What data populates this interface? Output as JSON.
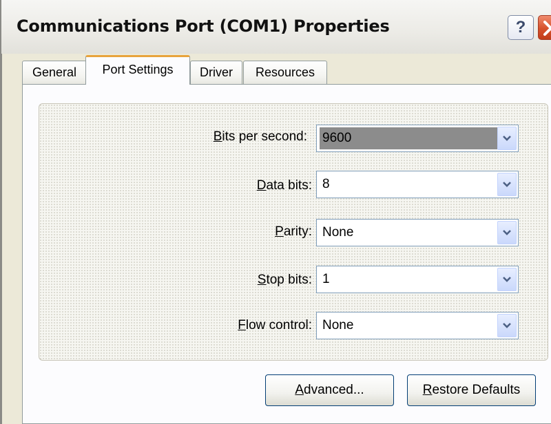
{
  "window": {
    "title": "Communications Port (COM1) Properties",
    "help_label": "?"
  },
  "tabs": [
    {
      "label": "General",
      "active": false
    },
    {
      "label": "Port Settings",
      "active": true
    },
    {
      "label": "Driver",
      "active": false
    },
    {
      "label": "Resources",
      "active": false
    }
  ],
  "settings": {
    "bits_per_second": {
      "label_access": "B",
      "label_rest": "its per second:",
      "value": "9600"
    },
    "data_bits": {
      "label_access": "D",
      "label_rest": "ata bits:",
      "value": "8"
    },
    "parity": {
      "label_access": "P",
      "label_rest": "arity:",
      "value": "None"
    },
    "stop_bits": {
      "label_access": "S",
      "label_rest": "top bits:",
      "value": "1"
    },
    "flow_control": {
      "label_access": "F",
      "label_rest": "low control:",
      "value": "None"
    }
  },
  "buttons": {
    "advanced": {
      "access": "A",
      "rest": "dvanced..."
    },
    "restore": {
      "access": "R",
      "rest": "estore Defaults"
    }
  },
  "colors": {
    "accent_tab": "#e8a33b",
    "close_button": "#d6502a",
    "selection": "#8c8c8c"
  }
}
